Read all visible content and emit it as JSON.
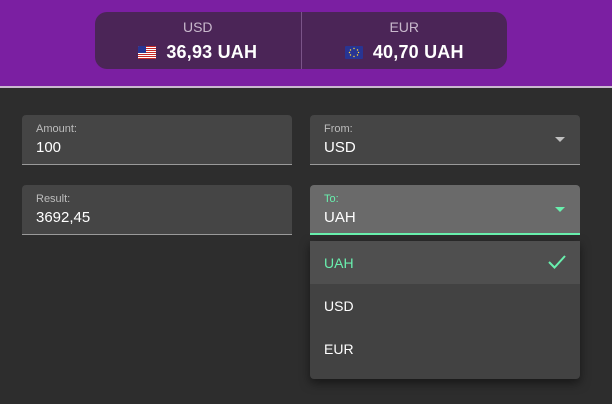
{
  "header": {
    "rates": [
      {
        "code": "USD",
        "value": "36,93 UAH",
        "flag_icon": "us-flag-icon"
      },
      {
        "code": "EUR",
        "value": "40,70 UAH",
        "flag_icon": "eu-flag-icon"
      }
    ]
  },
  "form": {
    "amount": {
      "label": "Amount:",
      "value": "100"
    },
    "from": {
      "label": "From:",
      "value": "USD"
    },
    "result": {
      "label": "Result:",
      "value": "3692,45"
    },
    "to": {
      "label": "To:",
      "value": "UAH"
    }
  },
  "dropdown": {
    "options": [
      "UAH",
      "USD",
      "EUR"
    ],
    "selected": "UAH",
    "selected_icon": "check-icon"
  },
  "colors": {
    "header_bg": "#7b1fa2",
    "accent": "#69f0ae",
    "page_bg": "#2d2d2d"
  }
}
